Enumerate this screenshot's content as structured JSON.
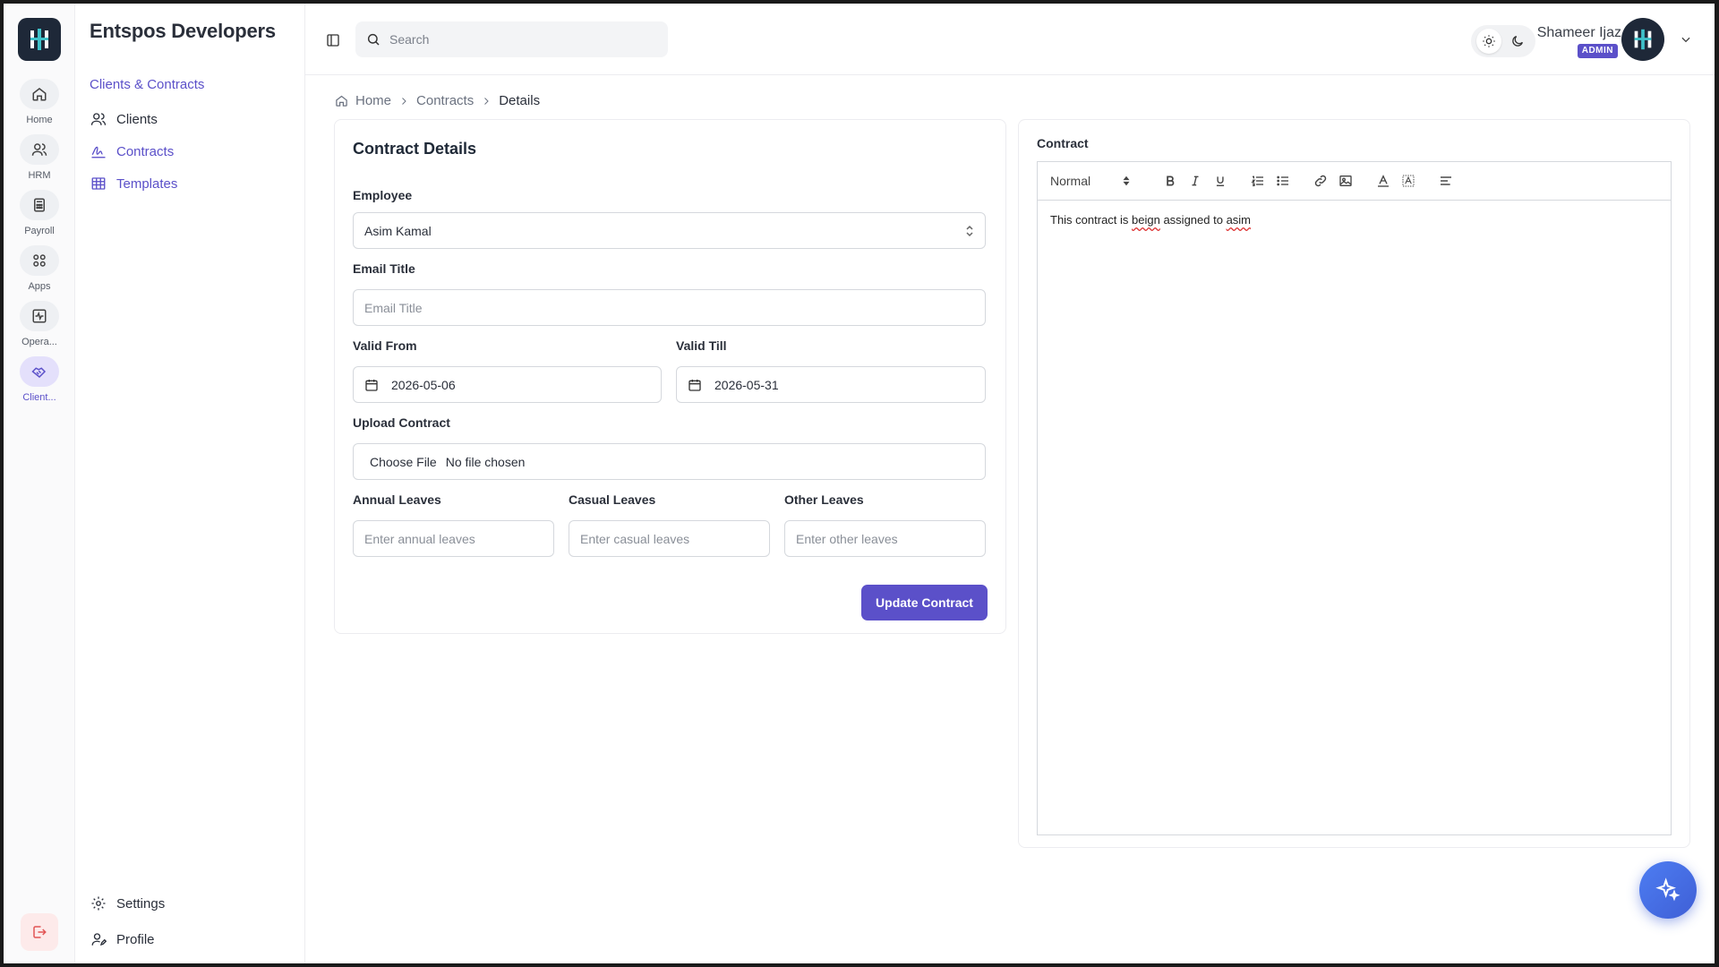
{
  "org": {
    "name": "Entspos Developers"
  },
  "rail": {
    "items": [
      {
        "label": "Home",
        "icon": "home-icon"
      },
      {
        "label": "HRM",
        "icon": "users-icon"
      },
      {
        "label": "Payroll",
        "icon": "calculator-icon"
      },
      {
        "label": "Apps",
        "icon": "grid-icon"
      },
      {
        "label": "Opera...",
        "icon": "pulse-icon"
      },
      {
        "label": "Client...",
        "icon": "handshake-icon"
      }
    ]
  },
  "sidebar": {
    "section": "Clients & Contracts",
    "items": [
      {
        "label": "Clients",
        "icon": "users-icon"
      },
      {
        "label": "Contracts",
        "icon": "signature-icon"
      },
      {
        "label": "Templates",
        "icon": "table-icon"
      }
    ],
    "footer": [
      {
        "label": "Settings",
        "icon": "gear-icon"
      },
      {
        "label": "Profile",
        "icon": "user-icon"
      }
    ]
  },
  "topbar": {
    "search_placeholder": "Search",
    "user_name": "Shameer Ijaz",
    "role": "ADMIN"
  },
  "breadcrumb": {
    "home": "Home",
    "contracts": "Contracts",
    "current": "Details"
  },
  "form": {
    "title": "Contract Details",
    "employee_label": "Employee",
    "employee_value": "Asim Kamal",
    "email_title_label": "Email Title",
    "email_title_placeholder": "Email Title",
    "valid_from_label": "Valid From",
    "valid_from_value": "2026-05-06",
    "valid_till_label": "Valid Till",
    "valid_till_value": "2026-05-31",
    "upload_label": "Upload Contract",
    "choose_file": "Choose File",
    "no_file": "No file chosen",
    "annual_label": "Annual Leaves",
    "annual_placeholder": "Enter annual leaves",
    "casual_label": "Casual Leaves",
    "casual_placeholder": "Enter casual leaves",
    "other_label": "Other Leaves",
    "other_placeholder": "Enter other leaves",
    "submit": "Update Contract"
  },
  "editor": {
    "label": "Contract",
    "format": "Normal",
    "text_before": "This contract is ",
    "word1": "beign",
    "text_middle": " assigned to ",
    "word2": "asim"
  },
  "colors": {
    "accent": "#5b50c9",
    "fab": "#4d7df2"
  }
}
